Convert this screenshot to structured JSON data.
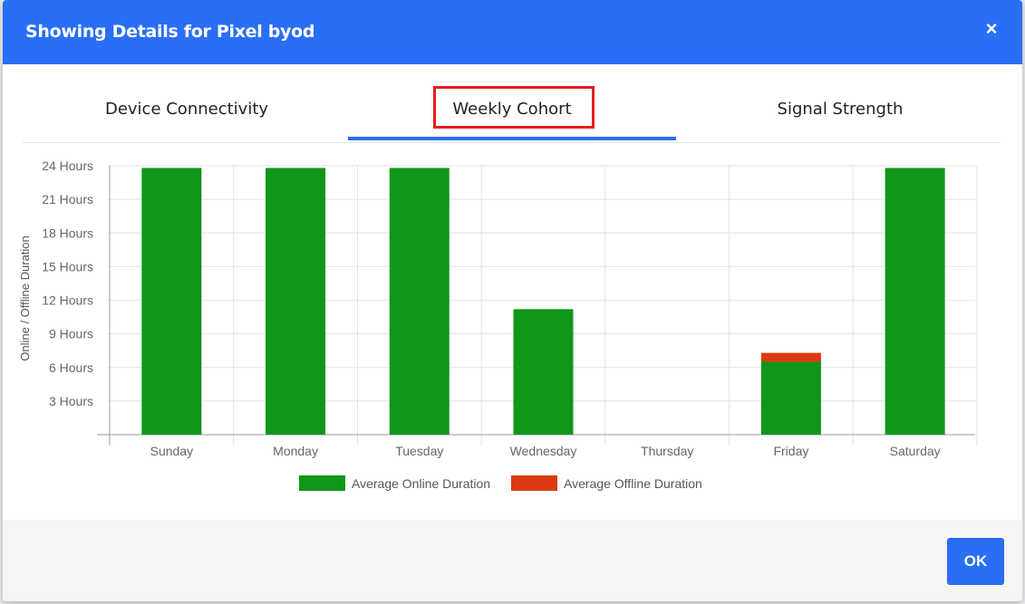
{
  "modal": {
    "title": "Showing Details for Pixel byod",
    "close_label": "×",
    "ok_label": "OK"
  },
  "tabs": [
    {
      "label": "Device Connectivity",
      "active": false
    },
    {
      "label": "Weekly Cohort",
      "active": true
    },
    {
      "label": "Signal Strength",
      "active": false
    }
  ],
  "colors": {
    "header": "#2a6ef5",
    "online": "#109618",
    "offline": "#dc3912",
    "highlight": "#e51c1c"
  },
  "chart_data": {
    "type": "bar",
    "stacked": true,
    "ylabel": "Online / Offline Duration",
    "ylim": [
      0,
      24
    ],
    "yticks": [
      "3 Hours",
      "6 Hours",
      "9 Hours",
      "12 Hours",
      "15 Hours",
      "18 Hours",
      "21 Hours",
      "24 Hours"
    ],
    "ytick_values": [
      3,
      6,
      9,
      12,
      15,
      18,
      21,
      24
    ],
    "categories": [
      "Sunday",
      "Monday",
      "Tuesday",
      "Wednesday",
      "Thursday",
      "Friday",
      "Saturday"
    ],
    "series": [
      {
        "name": "Average Online Duration",
        "color": "#109618",
        "values": [
          23.8,
          23.8,
          23.8,
          11.2,
          0,
          6.5,
          23.8
        ]
      },
      {
        "name": "Average Offline Duration",
        "color": "#dc3912",
        "values": [
          0,
          0,
          0,
          0,
          0,
          0.8,
          0
        ]
      }
    ],
    "legend_position": "bottom",
    "grid": true
  }
}
